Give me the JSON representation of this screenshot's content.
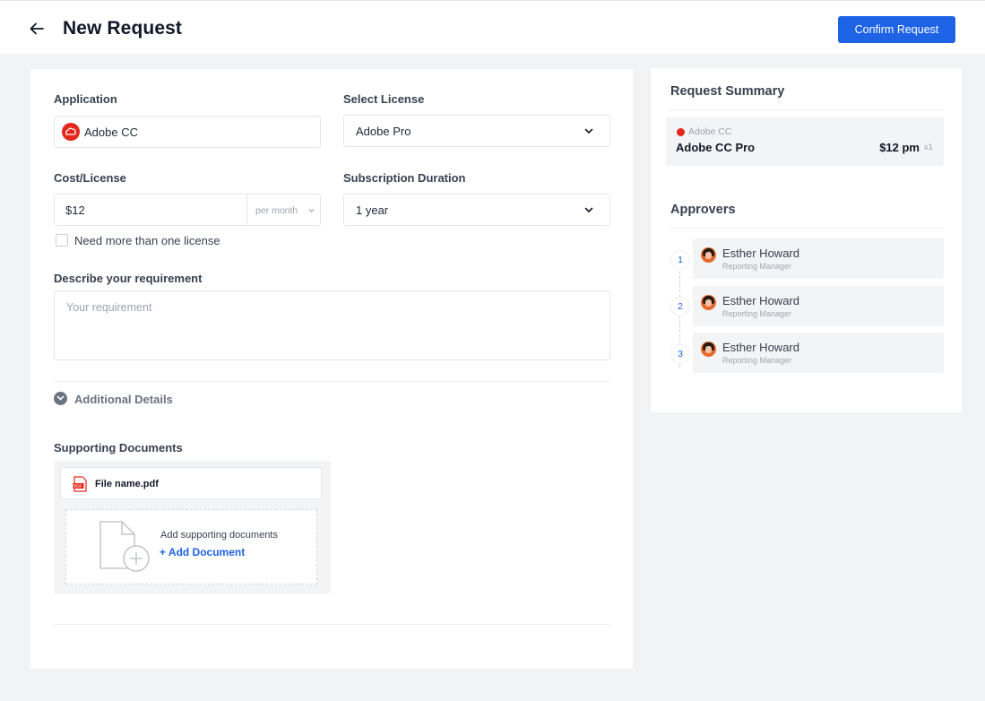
{
  "header": {
    "title": "New Request",
    "confirm_label": "Confirm Request"
  },
  "form": {
    "application": {
      "label": "Application",
      "value": "Adobe CC",
      "icon": "adobe-cc-icon",
      "icon_color": "#e5271c"
    },
    "license": {
      "label": "Select License",
      "value": "Adobe Pro"
    },
    "cost": {
      "label": "Cost/License",
      "value": "$12",
      "unit": "per month"
    },
    "duration": {
      "label": "Subscription Duration",
      "value": "1 year"
    },
    "multi_license": {
      "label": "Need more than one license",
      "checked": false
    },
    "requirement": {
      "label": "Describe your requirement",
      "placeholder": "Your requirement"
    },
    "additional_details_label": "Additional Details",
    "documents": {
      "label": "Supporting Documents",
      "files": [
        {
          "name": "File name.pdf"
        }
      ],
      "drop_text": "Add supporting documents",
      "add_label": "+ Add Document"
    }
  },
  "summary": {
    "title": "Request Summary",
    "item": {
      "app": "Adobe CC",
      "license": "Adobe CC Pro",
      "price": "$12 pm",
      "qty": "x1"
    }
  },
  "approvers": {
    "title": "Approvers",
    "items": [
      {
        "step": "1",
        "name": "Esther Howard",
        "role": "Reporting Manager"
      },
      {
        "step": "2",
        "name": "Esther Howard",
        "role": "Reporting Manager"
      },
      {
        "step": "3",
        "name": "Esther Howard",
        "role": "Reporting Manager"
      }
    ]
  },
  "colors": {
    "accent": "#1e62e6",
    "background": "#f2f3f5",
    "brand_adobe": "#e5271c"
  }
}
